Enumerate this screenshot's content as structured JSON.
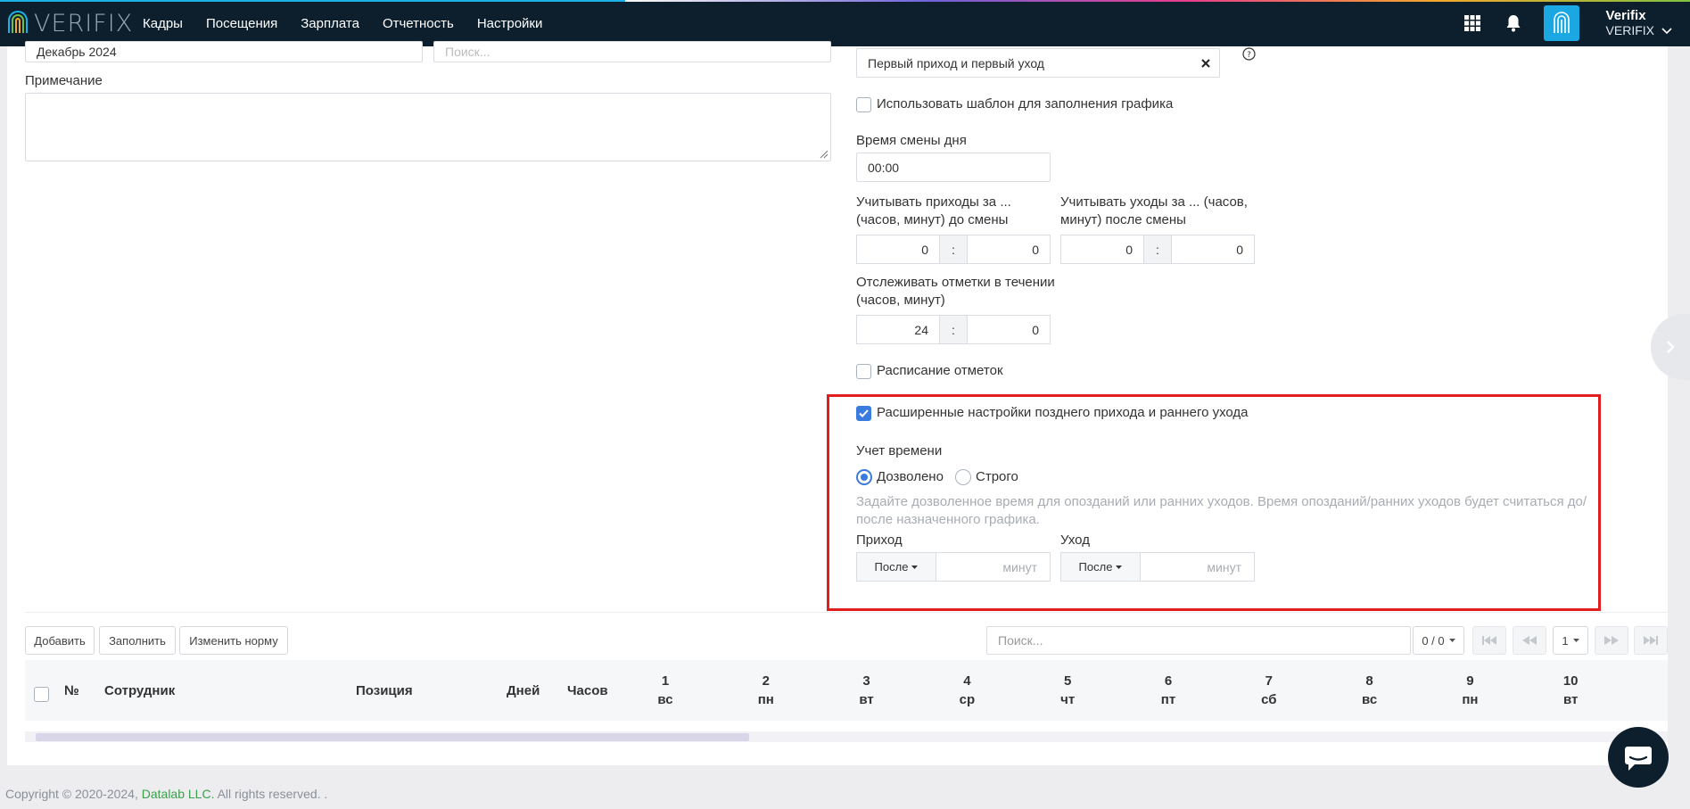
{
  "header": {
    "logo_text": "VERIFIX",
    "nav": [
      "Кадры",
      "Посещения",
      "Зарплата",
      "Отчетность",
      "Настройки"
    ],
    "user_name": "Verifix",
    "company": "VERIFIX"
  },
  "form": {
    "period_value": "Декабрь 2024",
    "search_placeholder": "Поиск...",
    "note_label": "Примечание",
    "template_value": "Первый приход и первый уход",
    "use_template_label": "Использовать шаблон для заполнения графика",
    "shift_time_label": "Время смены дня",
    "shift_time_value": "00:00",
    "arrivals_label": "Учитывать приходы за ... (часов, минут) до смены",
    "arrivals_hours": "0",
    "arrivals_minutes": "0",
    "leaves_label": "Учитывать уходы за ... (часов, минут) после смены",
    "leaves_hours": "0",
    "leaves_minutes": "0",
    "track_label": "Отслеживать отметки в течении (часов, минут)",
    "track_hours": "24",
    "track_minutes": "0",
    "colon": ":",
    "schedule_marks_label": "Расписание отметок",
    "advanced_label": "Расширенные настройки позднего прихода и раннего ухода",
    "time_accounting_label": "Учет времени",
    "radio_allowed": "Дозволено",
    "radio_strict": "Строго",
    "hint": "Задайте дозволенное время для опозданий или ранних уходов. Время опозданий/ранних уходов будет считаться до/после назначенного графика.",
    "arrival_label": "Приход",
    "arrival_select": "После",
    "arrival_unit": "минут",
    "leave_label": "Уход",
    "leave_select": "После",
    "leave_unit": "минут"
  },
  "toolbar": {
    "add": "Добавить",
    "fill": "Заполнить",
    "change_norm": "Изменить норму",
    "search_placeholder": "Поиск...",
    "count": "0 / 0",
    "page": "1"
  },
  "table": {
    "columns": [
      "№",
      "Сотрудник",
      "Позиция",
      "Дней",
      "Часов"
    ],
    "days": [
      {
        "num": "1",
        "dow": "вс"
      },
      {
        "num": "2",
        "dow": "пн"
      },
      {
        "num": "3",
        "dow": "вт"
      },
      {
        "num": "4",
        "dow": "ср"
      },
      {
        "num": "5",
        "dow": "чт"
      },
      {
        "num": "6",
        "dow": "пт"
      },
      {
        "num": "7",
        "dow": "сб"
      },
      {
        "num": "8",
        "dow": "вс"
      },
      {
        "num": "9",
        "dow": "пн"
      },
      {
        "num": "10",
        "dow": "вт"
      }
    ]
  },
  "footer": {
    "copyright": "Copyright © 2020-2024,",
    "company_link": "Datalab LLC.",
    "rights": "All rights reserved. ."
  },
  "colors": {
    "header_bg": "#0d1f2d",
    "accent": "#1ba7e2",
    "checkbox_checked": "#3a7be0",
    "highlight_box": "#e11d1d",
    "footer_link": "#3aa04a"
  }
}
